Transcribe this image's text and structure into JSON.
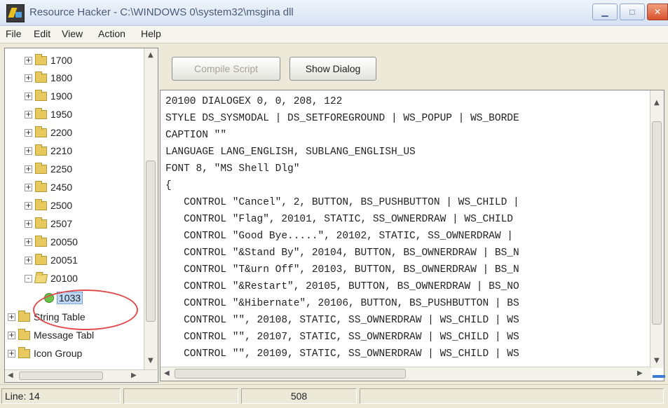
{
  "window": {
    "title": "Resource Hacker  -  C:\\WINDOWS 0\\system32\\msgina dll"
  },
  "menu": [
    "File",
    "Edit",
    "View",
    "Action",
    "Help"
  ],
  "tree": {
    "items": [
      {
        "label": "1700",
        "expander": "+"
      },
      {
        "label": "1800",
        "expander": "+"
      },
      {
        "label": "1900",
        "expander": "+"
      },
      {
        "label": "1950",
        "expander": "+"
      },
      {
        "label": "2200",
        "expander": "+"
      },
      {
        "label": "2210",
        "expander": "+"
      },
      {
        "label": "2250",
        "expander": "+"
      },
      {
        "label": "2450",
        "expander": "+"
      },
      {
        "label": "2500",
        "expander": "+"
      },
      {
        "label": "2507",
        "expander": "+"
      },
      {
        "label": "20050",
        "expander": "+"
      },
      {
        "label": "20051",
        "expander": "+"
      },
      {
        "label": "20100",
        "expander": "-"
      }
    ],
    "selected_leaf": "1033",
    "groups": [
      {
        "label": "String Table",
        "expander": "+"
      },
      {
        "label": "Message Tabl",
        "expander": "+"
      },
      {
        "label": "Icon Group",
        "expander": "+"
      }
    ]
  },
  "toolbar": {
    "compile_label": "Compile Script",
    "show_dialog_label": "Show Dialog"
  },
  "editor": {
    "lines": [
      "20100 DIALOGEX 0, 0, 208, 122",
      "STYLE DS_SYSMODAL | DS_SETFOREGROUND | WS_POPUP | WS_BORDE",
      "CAPTION \"\"",
      "LANGUAGE LANG_ENGLISH, SUBLANG_ENGLISH_US",
      "FONT 8, \"MS Shell Dlg\"",
      "{",
      "   CONTROL \"Cancel\", 2, BUTTON, BS_PUSHBUTTON | WS_CHILD |",
      "   CONTROL \"Flag\", 20101, STATIC, SS_OWNERDRAW | WS_CHILD",
      "   CONTROL \"Good Bye.....\", 20102, STATIC, SS_OWNERDRAW |",
      "   CONTROL \"&Stand By\", 20104, BUTTON, BS_OWNERDRAW | BS_N",
      "   CONTROL \"T&urn Off\", 20103, BUTTON, BS_OWNERDRAW | BS_N",
      "   CONTROL \"&Restart\", 20105, BUTTON, BS_OWNERDRAW | BS_NO",
      "   CONTROL \"&Hibernate\", 20106, BUTTON, BS_PUSHBUTTON | BS",
      "   CONTROL \"\", 20108, STATIC, SS_OWNERDRAW | WS_CHILD | WS",
      "   CONTROL \"\", 20107, STATIC, SS_OWNERDRAW | WS_CHILD | WS",
      "   CONTROL \"\", 20109, STATIC, SS_OWNERDRAW | WS_CHILD | WS"
    ]
  },
  "status": {
    "line": "Line: 14",
    "position": "508"
  },
  "icons": [
    "app-icon",
    "minimize-icon",
    "maximize-icon",
    "close-icon",
    "folder-icon",
    "dialog-resource-icon"
  ],
  "colors": {
    "selection_ring": "#e04a4a",
    "selected_bg": "#bcd6f5"
  }
}
